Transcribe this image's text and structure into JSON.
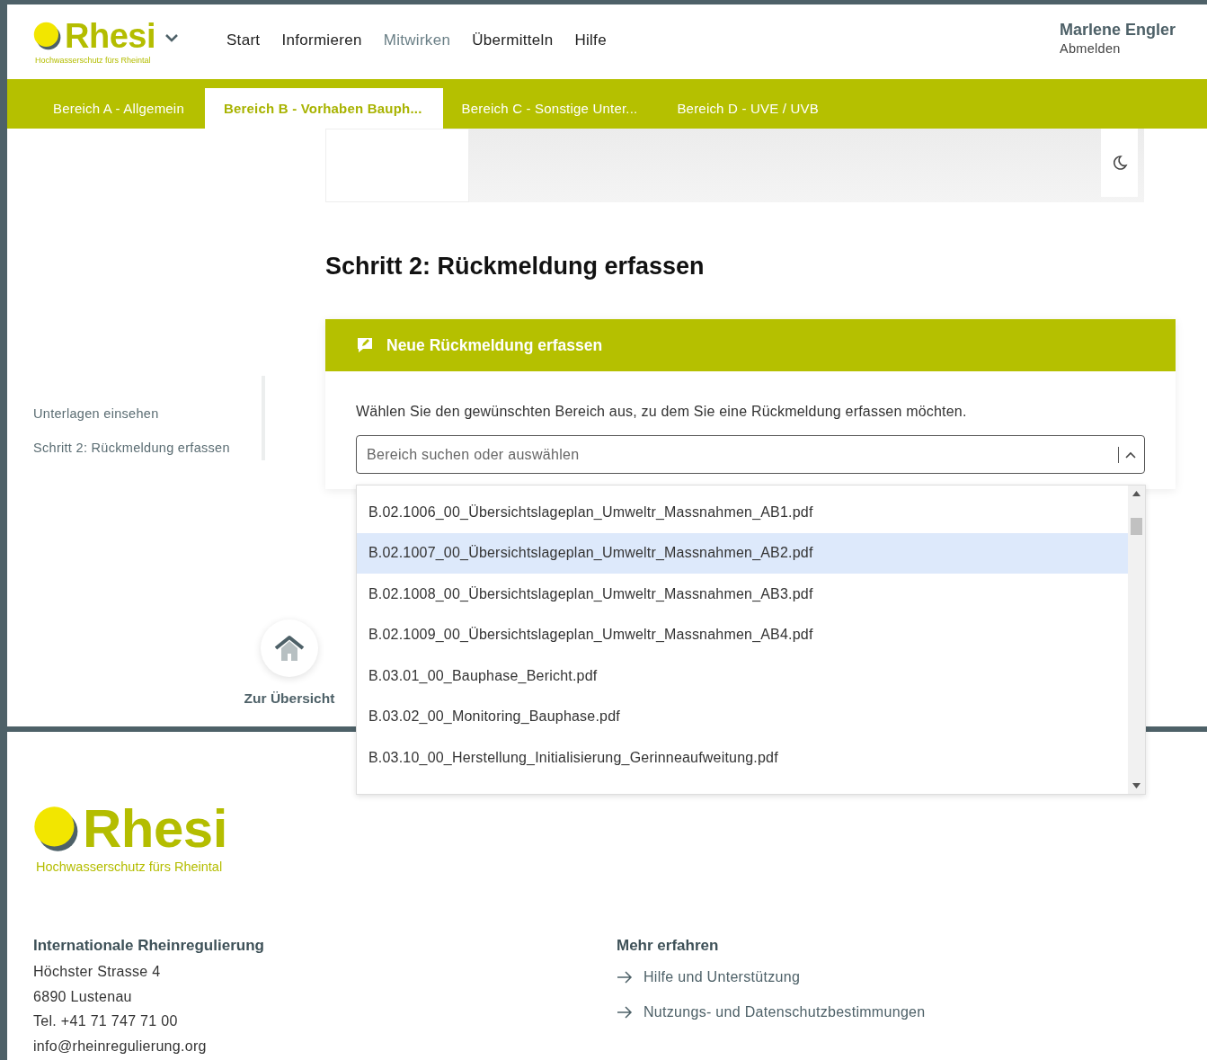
{
  "header": {
    "logo": {
      "name": "Rhesi",
      "tagline": "Hochwasserschutz fürs Rheintal"
    },
    "nav": [
      {
        "label": "Start",
        "selected": false
      },
      {
        "label": "Informieren",
        "selected": false
      },
      {
        "label": "Mitwirken",
        "selected": true
      },
      {
        "label": "Übermitteln",
        "selected": false
      },
      {
        "label": "Hilfe",
        "selected": false
      }
    ],
    "user": {
      "name": "Marlene Engler",
      "logout": "Abmelden"
    }
  },
  "tabs": [
    {
      "label": "Bereich A - Allgemein",
      "selected": false
    },
    {
      "label": "Bereich B - Vorhaben Bauph...",
      "selected": true
    },
    {
      "label": "Bereich C - Sonstige Unter...",
      "selected": false
    },
    {
      "label": "Bereich D - UVE / UVB",
      "selected": false
    }
  ],
  "sidebar": {
    "items": [
      {
        "label": "Unterlagen einsehen"
      },
      {
        "label": "Schritt 2: Rückmeldung erfassen"
      }
    ]
  },
  "home": {
    "label": "Zur Übersicht"
  },
  "heading": "Schritt 2: Rückmeldung erfassen",
  "card": {
    "title": "Neue Rückmeldung erfassen",
    "instruction": "Wählen Sie den gewünschten Bereich aus, zu dem Sie eine Rückmeldung erfassen möchten.",
    "select": {
      "placeholder": "Bereich suchen oder auswählen",
      "expanded": true,
      "options": [
        {
          "label": "B.02.1006_00_Übersichtslageplan_Umweltr_Massnahmen_AB1.pdf",
          "selected": false
        },
        {
          "label": "B.02.1007_00_Übersichtslageplan_Umweltr_Massnahmen_AB2.pdf",
          "selected": true
        },
        {
          "label": "B.02.1008_00_Übersichtslageplan_Umweltr_Massnahmen_AB3.pdf",
          "selected": false
        },
        {
          "label": "B.02.1009_00_Übersichtslageplan_Umweltr_Massnahmen_AB4.pdf",
          "selected": false
        },
        {
          "label": "B.03.01_00_Bauphase_Bericht.pdf",
          "selected": false
        },
        {
          "label": "B.03.02_00_Monitoring_Bauphase.pdf",
          "selected": false
        },
        {
          "label": "B.03.10_00_Herstellung_Initialisierung_Gerinneaufweitung.pdf",
          "selected": false
        }
      ]
    }
  },
  "footer": {
    "logo": {
      "name": "Rhesi",
      "tagline": "Hochwasserschutz fürs Rheintal"
    },
    "contact": {
      "title": "Internationale Rheinregulierung",
      "lines": [
        "Höchster Strasse 4",
        "6890 Lustenau",
        "Tel. +41 71 747 71 00",
        "info@rheinregulierung.org"
      ]
    },
    "links": {
      "title": "Mehr erfahren",
      "items": [
        "Hilfe und Unterstützung",
        "Nutzungs- und Datenschutzbestimmungen"
      ]
    }
  }
}
